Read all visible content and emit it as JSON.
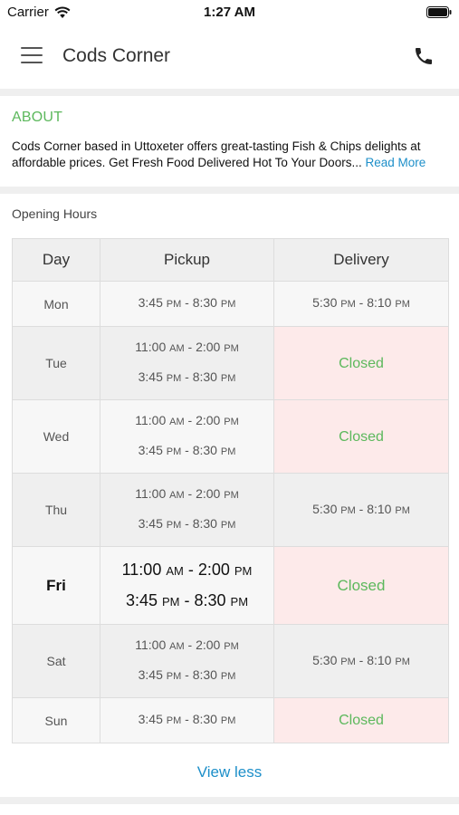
{
  "status_bar": {
    "carrier": "Carrier",
    "time": "1:27 AM"
  },
  "header": {
    "title": "Cods Corner",
    "menu_icon": "hamburger-menu-icon",
    "phone_icon": "phone-icon"
  },
  "about": {
    "heading": "ABOUT",
    "text": "Cods Corner based in Uttoxeter offers great-tasting Fish & Chips delights at affordable prices. Get Fresh Food Delivered Hot To Your Doors",
    "ellipsis": "...",
    "read_more": "Read More"
  },
  "opening_hours": {
    "title": "Opening Hours",
    "columns": [
      "Day",
      "Pickup",
      "Delivery"
    ],
    "rows": [
      {
        "day": "Mon",
        "pickup": [
          "3:45 PM - 8:30 PM"
        ],
        "delivery": [
          "5:30 PM - 8:10 PM"
        ]
      },
      {
        "day": "Tue",
        "pickup": [
          "11:00 AM - 2:00 PM",
          "3:45 PM - 8:30 PM"
        ],
        "delivery": [
          "Closed"
        ]
      },
      {
        "day": "Wed",
        "pickup": [
          "11:00 AM - 2:00 PM",
          "3:45 PM - 8:30 PM"
        ],
        "delivery": [
          "Closed"
        ]
      },
      {
        "day": "Thu",
        "pickup": [
          "11:00 AM - 2:00 PM",
          "3:45 PM - 8:30 PM"
        ],
        "delivery": [
          "5:30 PM - 8:10 PM"
        ]
      },
      {
        "day": "Fri",
        "pickup": [
          "11:00 AM - 2:00 PM",
          "3:45 PM - 8:30 PM"
        ],
        "delivery": [
          "Closed"
        ],
        "today": true
      },
      {
        "day": "Sat",
        "pickup": [
          "11:00 AM - 2:00 PM",
          "3:45 PM - 8:30 PM"
        ],
        "delivery": [
          "5:30 PM - 8:10 PM"
        ]
      },
      {
        "day": "Sun",
        "pickup": [
          "3:45 PM - 8:30 PM"
        ],
        "delivery": [
          "Closed"
        ]
      }
    ],
    "view_less": "View less"
  },
  "colors": {
    "accent_green": "#5cb85c",
    "link_blue": "#1d8fc9",
    "closed_bg": "#fdeaea"
  }
}
